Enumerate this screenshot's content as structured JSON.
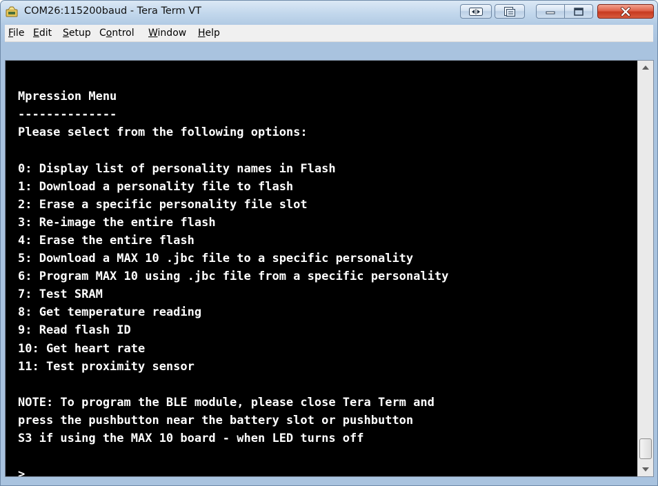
{
  "window": {
    "title": "COM26:115200baud - Tera Term VT"
  },
  "menu": {
    "items": [
      {
        "accel": "F",
        "rest": "ile"
      },
      {
        "accel": "E",
        "rest": "dit"
      },
      {
        "accel": "S",
        "rest": "etup"
      },
      {
        "pre": "C",
        "accel": "o",
        "rest": "ntrol"
      },
      {
        "accel": "W",
        "rest": "indow"
      },
      {
        "accel": "H",
        "rest": "elp"
      }
    ]
  },
  "terminal": {
    "lines": [
      "",
      "Mpression Menu",
      "--------------",
      "Please select from the following options:",
      "",
      "0: Display list of personality names in Flash",
      "1: Download a personality file to flash",
      "2: Erase a specific personality file slot",
      "3: Re-image the entire flash",
      "4: Erase the entire flash",
      "5: Download a MAX 10 .jbc file to a specific personality",
      "6: Program MAX 10 using .jbc file from a specific personality",
      "7: Test SRAM",
      "8: Get temperature reading",
      "9: Read flash ID",
      "10: Get heart rate",
      "11: Test proximity sensor",
      "",
      "NOTE: To program the BLE module, please close Tera Term and",
      "press the pushbutton near the battery slot or pushbutton",
      "S3 if using the MAX 10 board - when LED turns off",
      "",
      ">"
    ],
    "colors": {
      "background": "#000000",
      "foreground": "#ffffff"
    }
  },
  "scrollbar": {
    "position": 0.95
  },
  "icons": {
    "app": "tera-term-icon",
    "titlebar_buttons": [
      "arrows-icon",
      "copy-icon",
      "minimize-icon",
      "maximize-icon",
      "close-icon"
    ]
  }
}
